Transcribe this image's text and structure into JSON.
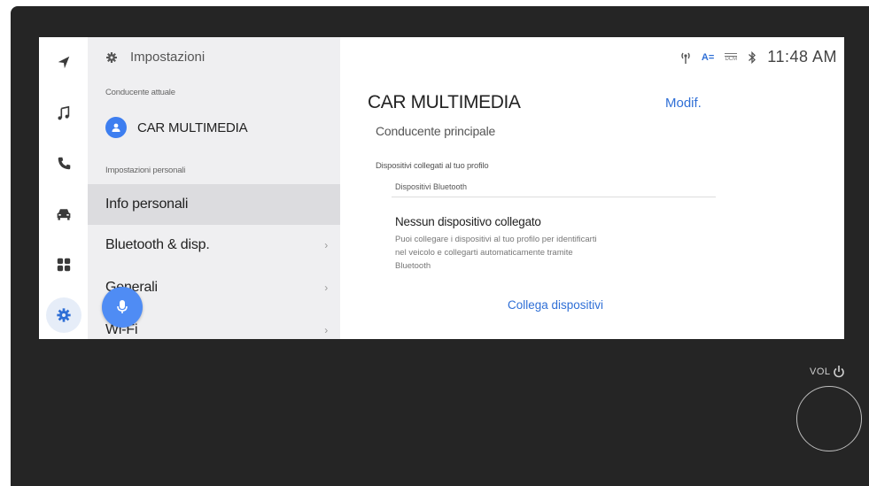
{
  "menu": {
    "title": "Impostazioni",
    "current_driver_label": "Conducente attuale",
    "current_driver_name": "CAR MULTIMEDIA",
    "personal_settings_label": "Impostazioni personali",
    "items": [
      {
        "label": "Info personali",
        "chevron": ""
      },
      {
        "label": "Bluetooth & disp.",
        "chevron": "›"
      },
      {
        "label": "Generali",
        "chevron": "›"
      },
      {
        "label": "Wi-Fi",
        "chevron": "›"
      }
    ]
  },
  "status": {
    "time": "11:48 AM",
    "az_label": "A=",
    "dcm_label": "DCM"
  },
  "main": {
    "profile_name": "CAR MULTIMEDIA",
    "edit_label": "Modif.",
    "profile_role": "Conducente principale",
    "devices_section_label": "Dispositivi collegati al tuo profilo",
    "bluetooth_label": "Dispositivi Bluetooth",
    "no_device_title": "Nessun dispositivo collegato",
    "no_device_desc": "Puoi collegare i dispositivi al tuo profilo per identificarti nel veicolo e collegarti automaticamente tramite Bluetooth",
    "connect_label": "Collega dispositivi"
  },
  "hardware": {
    "volume_label": "VOL"
  },
  "icons": {
    "rail": [
      "navigation-arrow-icon",
      "music-note-icon",
      "phone-icon",
      "car-icon",
      "apps-grid-icon",
      "settings-gear-icon"
    ],
    "status": [
      "signal-icon",
      "az-icon",
      "dcm-icon",
      "bluetooth-icon"
    ]
  },
  "colors": {
    "accent": "#3d7ef0",
    "link": "#2f6fd6",
    "menu_bg": "#efeff1",
    "selected_bg": "#dcdcdf",
    "bezel": "#252525"
  }
}
